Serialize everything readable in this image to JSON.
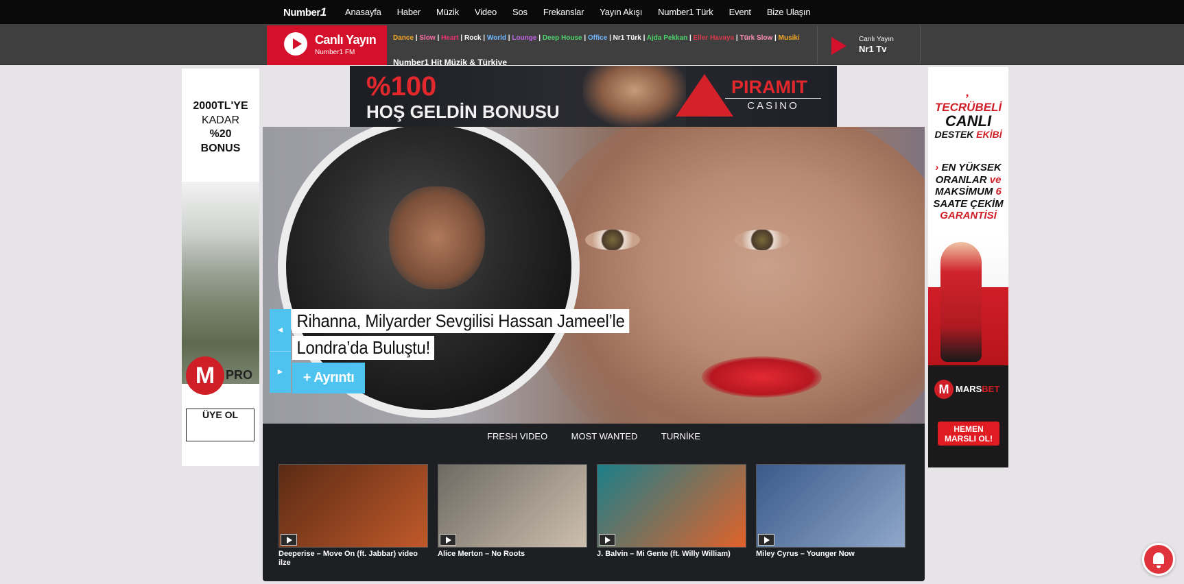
{
  "site": {
    "logo_text": "Number",
    "logo_mark": "1"
  },
  "nav": {
    "items": [
      "Anasayfa",
      "Haber",
      "Müzik",
      "Video",
      "Sos",
      "Frekanslar",
      "Yayın Akışı",
      "Number1 Türk",
      "Event",
      "Bize Ulaşın"
    ]
  },
  "radio": {
    "live_title": "Canlı Yayın",
    "live_subtitle": "Number1 FM",
    "genres": [
      {
        "label": "Dance",
        "color": "#f5a623"
      },
      {
        "label": "Slow",
        "color": "#ff6fa8"
      },
      {
        "label": "Heart",
        "color": "#e8336b"
      },
      {
        "label": "Rock",
        "color": "#ffffff"
      },
      {
        "label": "World",
        "color": "#6fb8ff"
      },
      {
        "label": "Lounge",
        "color": "#c267e8"
      },
      {
        "label": "Deep House",
        "color": "#4fd36b"
      },
      {
        "label": "Office",
        "color": "#6fb8ff"
      },
      {
        "label": "Nr1 Türk",
        "color": "#ffffff"
      },
      {
        "label": "Ajda Pekkan",
        "color": "#4fd36b"
      },
      {
        "label": "Eller Havaya",
        "color": "#d63a4a"
      },
      {
        "label": "Türk Slow",
        "color": "#ff8fb8"
      },
      {
        "label": "Musiki",
        "color": "#f5a623"
      }
    ],
    "now_playing": "Number1 Hit Müzik & Türkiye",
    "tv_label": "Canlı Yayın",
    "tv_name": "Nr1 Tv"
  },
  "left_ad": {
    "line1": "2000TL'YE",
    "line2": "KADAR",
    "line3": "%20",
    "line4": "BONUS",
    "brand_letter": "M",
    "brand_suffix": "PRO",
    "cta": "ÜYE OL"
  },
  "top_banner": {
    "headline": "%100",
    "subline": "HOŞ GELDİN BONUSU",
    "brand": "PIRAMIT",
    "brand_sub": "CASINO"
  },
  "hero": {
    "headline_line1": "Rihanna, Milyarder Sevgilisi Hassan Jameel’le",
    "headline_line2": "Londra’da Buluştu!",
    "more_label": "+ Ayrıntı",
    "prev_icon": "◄",
    "next_icon": "►"
  },
  "videos": {
    "tabs": [
      "FRESH VIDEO",
      "MOST WANTED",
      "TURNİKE"
    ],
    "items": [
      {
        "title": "Deeperise – Move On (ft. Jabbar) video ilze",
        "color1": "#5a2a14",
        "color2": "#c0592a"
      },
      {
        "title": "Alice Merton – No Roots",
        "color1": "#6e6a63",
        "color2": "#cdbfae"
      },
      {
        "title": "J. Balvin – Mi Gente (ft. Willy William)",
        "color1": "#1b7f8a",
        "color2": "#e0622a"
      },
      {
        "title": "Miley Cyrus – Younger Now",
        "color1": "#3a5a8a",
        "color2": "#8fa7c9"
      }
    ]
  },
  "right_ad": {
    "quote": "‚",
    "l1": "TECRÜBELİ",
    "l2": "CANLI",
    "l3a": "DESTEK",
    "l3b": "EKİBİ",
    "l4a": "›",
    "l4b": "EN YÜKSEK",
    "l5": "ORANLAR",
    "l5b": "ve",
    "l6a": "MAKSİMUM",
    "l6b": "6",
    "l7": "SAATE ÇEKİM",
    "l8": "GARANTİSİ",
    "brand_letter": "M",
    "brand_a": "MARS",
    "brand_b": "BET",
    "cta_l1": "HEMEN",
    "cta_l2": "MARSLI OL!"
  },
  "notification": {
    "icon": "bell-icon"
  }
}
